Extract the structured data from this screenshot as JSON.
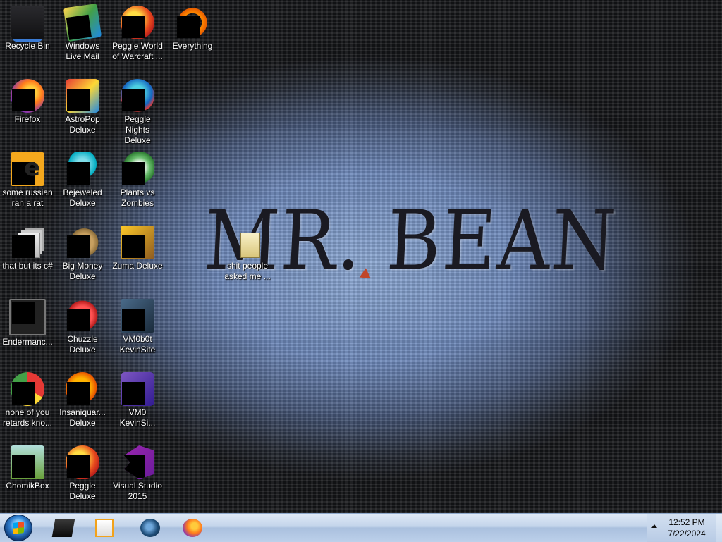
{
  "wallpaper": {
    "text": "MR. BEAN"
  },
  "desktop_icons": [
    {
      "label": "Recycle Bin",
      "icon": "recycle-bin-icon"
    },
    {
      "label": "Windows Live Mail",
      "icon": "windows-live-mail-icon"
    },
    {
      "label": "Peggle World of Warcraft ...",
      "icon": "peggle-wow-icon"
    },
    {
      "label": "Everything",
      "icon": "everything-search-icon"
    },
    {
      "label": "Firefox",
      "icon": "firefox-icon"
    },
    {
      "label": "AstroPop Deluxe",
      "icon": "astropop-icon"
    },
    {
      "label": "Peggle Nights Deluxe",
      "icon": "peggle-nights-icon"
    },
    {
      "label": "some russian ran a rat",
      "icon": "shortcut-e-icon"
    },
    {
      "label": "Bejeweled Deluxe",
      "icon": "bejeweled-icon"
    },
    {
      "label": "Plants vs Zombies",
      "icon": "plants-vs-zombies-icon"
    },
    {
      "label": "that but its c#",
      "icon": "pages-icon"
    },
    {
      "label": "Big Money Deluxe",
      "icon": "big-money-icon"
    },
    {
      "label": "Zuma Deluxe",
      "icon": "zuma-icon"
    },
    {
      "label": "shit people asked me ...",
      "icon": "text-document-icon"
    },
    {
      "label": "Endermanc...",
      "icon": "terminal-icon"
    },
    {
      "label": "Chuzzle Deluxe",
      "icon": "chuzzle-icon"
    },
    {
      "label": "VM0b0t KevinSite",
      "icon": "vm-icon"
    },
    {
      "label": "none of you retards kno...",
      "icon": "chrome-icon"
    },
    {
      "label": "Insaniquar... Deluxe",
      "icon": "insaniquarium-icon"
    },
    {
      "label": "VM0 KevinSi...",
      "icon": "vm-purple-icon"
    },
    {
      "label": "ChomikBox",
      "icon": "chomikbox-icon"
    },
    {
      "label": "Peggle Deluxe",
      "icon": "peggle-icon"
    },
    {
      "label": "Visual Studio 2015",
      "icon": "visual-studio-icon"
    }
  ],
  "taskbar": {
    "start_icon": "windows-start-icon",
    "pinned": [
      {
        "icon": "pinned-app-dark-icon"
      },
      {
        "icon": "media-player-icon"
      },
      {
        "icon": "globe-browser-icon"
      },
      {
        "icon": "firefox-icon"
      }
    ],
    "clock": {
      "time": "12:52 PM",
      "date": "7/22/2024"
    },
    "tray_chevron_icon": "chevron-up-icon"
  }
}
